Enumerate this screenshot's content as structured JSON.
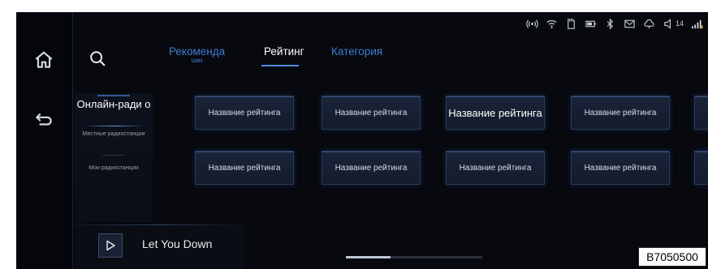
{
  "rail": {
    "home_icon": "home-icon",
    "back_icon": "back-arrow-icon"
  },
  "status_bar": {
    "icons": [
      "hotspot-icon",
      "wifi-icon",
      "sd-card-icon",
      "battery-icon",
      "bluetooth-icon",
      "mail-icon",
      "cloud-icon",
      "volume-icon",
      "signal-icon"
    ],
    "volume_level": "14"
  },
  "search_icon": "search-icon",
  "tabs": [
    {
      "label": "Рекоменда",
      "label_cut": "ции",
      "active": false
    },
    {
      "label": "Рейтинг",
      "active": true
    },
    {
      "label": "Категория",
      "active": false
    }
  ],
  "left_nav": {
    "online_radio": "Онлайн-ради о",
    "local_stations": "Местные радиостанции",
    "my_stations": "Мои радиостанции"
  },
  "rating_cards": [
    [
      "Название рейтинга",
      "Название рейтинга",
      "Название рейтинга",
      "Название рейтинга"
    ],
    [
      "Название рейтинга",
      "Название рейтинга",
      "Название рейтинга",
      "Название рейтинга"
    ]
  ],
  "player": {
    "song": "Let You Down",
    "play_icon": "play-icon"
  },
  "scroll_progress": 0.33,
  "watermark": "B7050500",
  "colors": {
    "accent": "#4a8de0",
    "tab_inactive": "#3f7fd0",
    "background": "#07090f"
  }
}
